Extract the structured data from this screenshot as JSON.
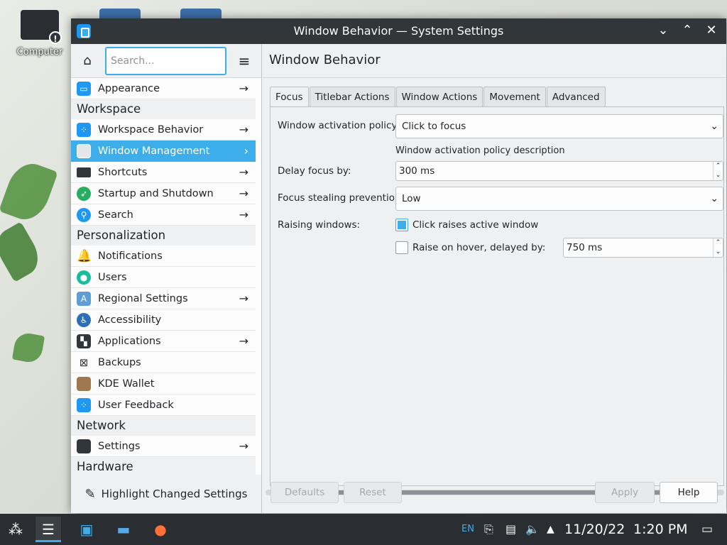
{
  "colors": {
    "accent": "#3daee9",
    "titlebar": "#31363b",
    "taskbar": "#2a2e32",
    "window_bg": "#eff0f1"
  },
  "desktop": {
    "computer_label": "Computer"
  },
  "window": {
    "title": "Window Behavior — System Settings",
    "controls": {
      "minimize": "⌄",
      "maximize": "⌃",
      "close": "✕"
    }
  },
  "sidebar": {
    "search_placeholder": "Search...",
    "groups": {
      "appearance": {
        "label": "Appearance",
        "icon": "appearance-icon"
      },
      "workspace": {
        "title": "Workspace",
        "items": [
          {
            "label": "Workspace Behavior",
            "icon": "workspace-icon"
          },
          {
            "label": "Window Management",
            "icon": "window-icon"
          },
          {
            "label": "Shortcuts",
            "icon": "keyboard-icon"
          },
          {
            "label": "Startup and Shutdown",
            "icon": "rocket-icon"
          },
          {
            "label": "Search",
            "icon": "search-icon"
          }
        ]
      },
      "personalization": {
        "title": "Personalization",
        "items": [
          {
            "label": "Notifications",
            "icon": "bell-icon"
          },
          {
            "label": "Users",
            "icon": "user-icon"
          },
          {
            "label": "Regional Settings",
            "icon": "language-icon"
          },
          {
            "label": "Accessibility",
            "icon": "accessibility-icon"
          },
          {
            "label": "Applications",
            "icon": "applications-icon"
          },
          {
            "label": "Backups",
            "icon": "backup-icon"
          },
          {
            "label": "KDE Wallet",
            "icon": "wallet-icon"
          },
          {
            "label": "User Feedback",
            "icon": "feedback-icon"
          }
        ]
      },
      "network": {
        "title": "Network",
        "items": [
          {
            "label": "Settings",
            "icon": "network-icon"
          }
        ]
      },
      "hardware": {
        "title": "Hardware"
      }
    },
    "footer_label": "Highlight Changed Settings"
  },
  "content": {
    "heading": "Window Behavior",
    "tabs": [
      "Focus",
      "Titlebar Actions",
      "Window Actions",
      "Movement",
      "Advanced"
    ],
    "active_tab": "Focus",
    "activation_policy": {
      "label": "Window activation policy:",
      "value": "Click to focus",
      "description": "Window activation policy description"
    },
    "delay_focus": {
      "label": "Delay focus by:",
      "value": "300 ms"
    },
    "focus_stealing": {
      "label": "Focus stealing prevention:",
      "value": "Low"
    },
    "raising": {
      "label": "Raising windows:",
      "click_raises": {
        "label": "Click raises active window",
        "checked": true
      },
      "raise_hover": {
        "label": "Raise on hover, delayed by:",
        "checked": false,
        "value": "750 ms"
      }
    },
    "buttons": {
      "defaults": "Defaults",
      "reset": "Reset",
      "apply": "Apply",
      "help": "Help"
    }
  },
  "taskbar": {
    "language": "EN",
    "date": "11/20/22",
    "time": "1:20 PM"
  }
}
